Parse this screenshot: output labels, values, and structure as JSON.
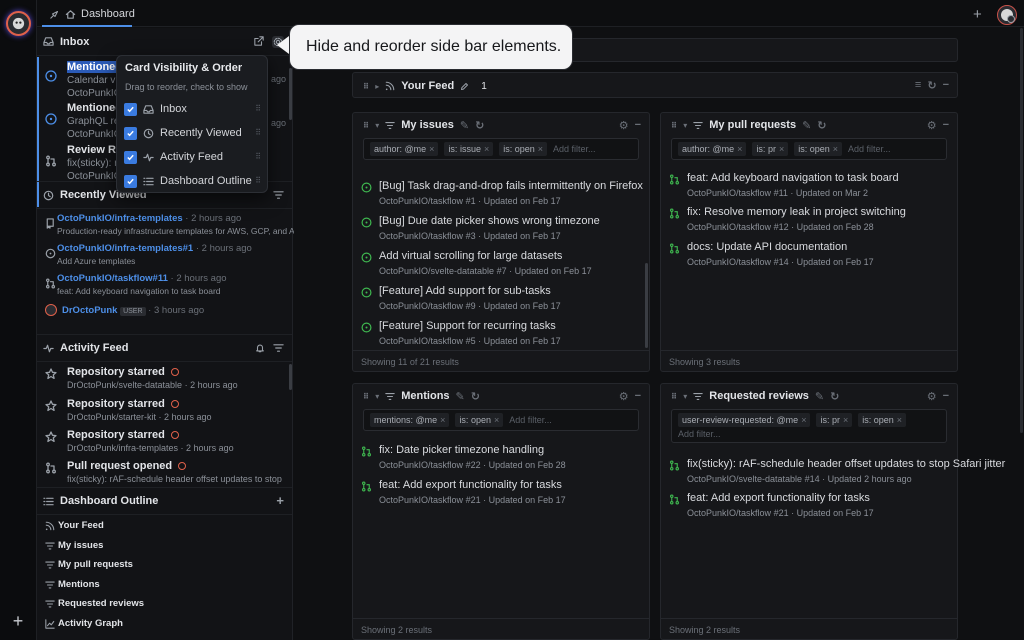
{
  "topbar": {
    "tab_label": "Dashboard"
  },
  "tooltip": {
    "text": "Hide and reorder side bar elements."
  },
  "popover": {
    "title": "Card Visibility & Order",
    "subtitle": "Drag to reorder, check to show",
    "items": [
      {
        "label": "Inbox",
        "checked": true
      },
      {
        "label": "Recently Viewed",
        "checked": true
      },
      {
        "label": "Activity Feed",
        "checked": true
      },
      {
        "label": "Dashboard Outline",
        "checked": true
      }
    ]
  },
  "sidebar": {
    "inbox": {
      "title": "Inbox",
      "items": [
        {
          "title": "Mentioned",
          "sub": "Calendar view",
          "sub2": "OctoPunkIO/ta",
          "time": "ago"
        },
        {
          "title": "Mentioned",
          "sub": "GraphQL reso",
          "sub2": "OctoPunkIO/ta",
          "time": "ago"
        },
        {
          "title": "Review Requ",
          "sub": "fix(sticky): rAF",
          "sub2": "OctoPunkIO/sv",
          "time": ""
        }
      ]
    },
    "recently_viewed": {
      "title": "Recently Viewed",
      "items": [
        {
          "name": "OctoPunkIO/infra-templates",
          "time": "2 hours ago",
          "desc": "Production-ready infrastructure templates for AWS, GCP, and Azure."
        },
        {
          "name": "OctoPunkIO/infra-templates#1",
          "time": "2 hours ago",
          "desc": "Add Azure templates"
        },
        {
          "name": "OctoPunkIO/taskflow#11",
          "time": "2 hours ago",
          "desc": "feat: Add keyboard navigation to task board"
        },
        {
          "name": "DrOctoPunk",
          "badge": "USER",
          "time": "3 hours ago"
        }
      ]
    },
    "activity_feed": {
      "title": "Activity Feed",
      "items": [
        {
          "title": "Repository starred",
          "sub": "DrOctoPunk/svelte-datatable",
          "time": "2 hours ago"
        },
        {
          "title": "Repository starred",
          "sub": "DrOctoPunk/starter-kit",
          "time": "2 hours ago"
        },
        {
          "title": "Repository starred",
          "sub": "DrOctoPunk/infra-templates",
          "time": "2 hours ago"
        },
        {
          "title": "Pull request opened",
          "sub": "fix(sticky): rAF-schedule header offset updates to stop Safari...",
          "time": ""
        }
      ]
    },
    "outline": {
      "title": "Dashboard Outline",
      "items": [
        "Your Feed",
        "My issues",
        "My pull requests",
        "Mentions",
        "Requested reviews",
        "Activity Graph"
      ]
    }
  },
  "feed": {
    "title": "Your Feed",
    "count": "1"
  },
  "cards": {
    "my_issues": {
      "title": "My issues",
      "chips": [
        "author: @me",
        "is: issue",
        "is: open"
      ],
      "placeholder": "Add filter...",
      "items": [
        {
          "title": "[Bug] Task drag-and-drop fails intermittently on Firefox",
          "repo": "OctoPunkIO/taskflow",
          "num": "#1",
          "updated": "Updated on Feb 17"
        },
        {
          "title": "[Bug] Due date picker shows wrong timezone",
          "repo": "OctoPunkIO/taskflow",
          "num": "#3",
          "updated": "Updated on Feb 17"
        },
        {
          "title": "Add virtual scrolling for large datasets",
          "repo": "OctoPunkIO/svelte-datatable",
          "num": "#7",
          "updated": "Updated on Feb 17"
        },
        {
          "title": "[Feature] Add support for sub-tasks",
          "repo": "OctoPunkIO/taskflow",
          "num": "#9",
          "updated": "Updated on Feb 17"
        },
        {
          "title": "[Feature] Support for recurring tasks",
          "repo": "OctoPunkIO/taskflow",
          "num": "#5",
          "updated": "Updated on Feb 17"
        }
      ],
      "footer": "Showing 11 of 21 results"
    },
    "my_prs": {
      "title": "My pull requests",
      "chips": [
        "author: @me",
        "is: pr",
        "is: open"
      ],
      "placeholder": "Add filter...",
      "items": [
        {
          "title": "feat: Add keyboard navigation to task board",
          "repo": "OctoPunkIO/taskflow",
          "num": "#11",
          "updated": "Updated on Mar 2"
        },
        {
          "title": "fix: Resolve memory leak in project switching",
          "repo": "OctoPunkIO/taskflow",
          "num": "#12",
          "updated": "Updated on Feb 28"
        },
        {
          "title": "docs: Update API documentation",
          "repo": "OctoPunkIO/taskflow",
          "num": "#14",
          "updated": "Updated on Feb 17"
        }
      ],
      "footer": "Showing 3 results"
    },
    "mentions": {
      "title": "Mentions",
      "chips": [
        "mentions: @me",
        "is: open"
      ],
      "placeholder": "Add filter...",
      "items": [
        {
          "title": "fix: Date picker timezone handling",
          "repo": "OctoPunkIO/taskflow",
          "num": "#22",
          "updated": "Updated on Feb 28"
        },
        {
          "title": "feat: Add export functionality for tasks",
          "repo": "OctoPunkIO/taskflow",
          "num": "#21",
          "updated": "Updated on Feb 17"
        }
      ],
      "footer": "Showing 2 results"
    },
    "requested_reviews": {
      "title": "Requested reviews",
      "chips": [
        "user-review-requested: @me",
        "is: pr",
        "is: open"
      ],
      "placeholder": "Add filter...",
      "items": [
        {
          "title": "fix(sticky): rAF-schedule header offset updates to stop Safari jitter",
          "repo": "OctoPunkIO/svelte-datatable",
          "num": "#14",
          "updated": "Updated 2 hours ago"
        },
        {
          "title": "feat: Add export functionality for tasks",
          "repo": "OctoPunkIO/taskflow",
          "num": "#21",
          "updated": "Updated on Feb 17"
        }
      ],
      "footer": "Showing 2 results"
    }
  },
  "colors": {
    "accent": "#4d8fe8",
    "open_issue": "#3fb950",
    "badge": "#e0614a"
  }
}
